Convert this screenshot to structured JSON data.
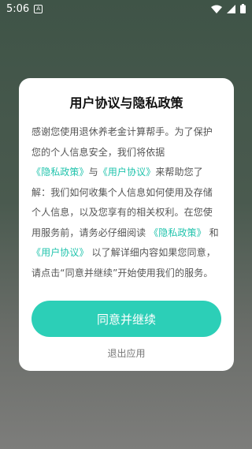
{
  "status_bar": {
    "time": "5:06",
    "notification_icon": "A"
  },
  "dialog": {
    "title": "用户协议与隐私政策",
    "body": [
      {
        "t": "感谢您使用退休养老金计算帮手。为了保护您的个人信息安全，我们将依据",
        "link": false
      },
      {
        "t": "《隐私政策》",
        "link": true
      },
      {
        "t": "与",
        "link": false
      },
      {
        "t": "《用户协议》",
        "link": true
      },
      {
        "t": "来帮助您了解：我们如何收集个人信息如何使用及存储个人信息，以及您享有的相关权利。在您使用服务前，请务必仔细阅读 ",
        "link": false
      },
      {
        "t": "《隐私政策》",
        "link": true
      },
      {
        "t": " 和 ",
        "link": false
      },
      {
        "t": "《用户协议》",
        "link": true
      },
      {
        "t": " 以了解详细内容如果您同意，请点击“同意并继续”开始使用我们的服务。",
        "link": false
      }
    ],
    "agree_button": "同意并继续",
    "exit_link": "退出应用"
  },
  "colors": {
    "accent": "#2ccfb7",
    "link": "#22c4ad"
  }
}
